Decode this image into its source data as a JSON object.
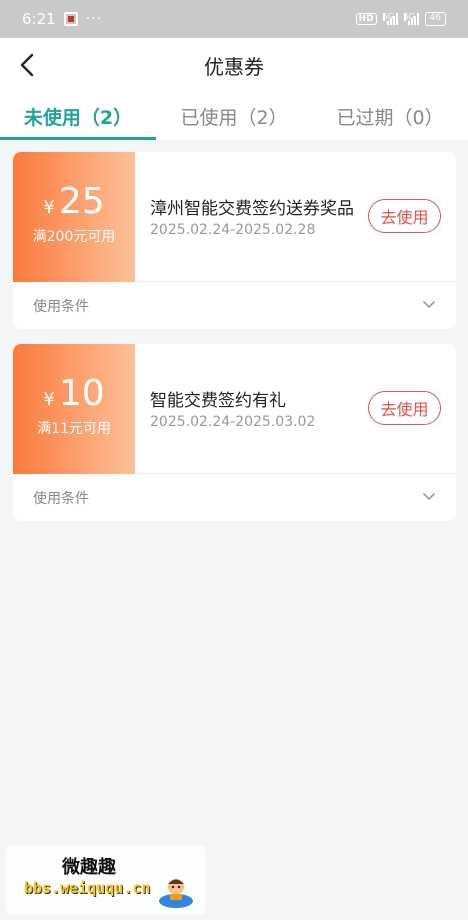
{
  "status_bar": {
    "time": "6:21",
    "dots": "···",
    "hd": "HD",
    "net1": "5G",
    "net2": "5G",
    "battery": "46"
  },
  "header": {
    "title": "优惠券"
  },
  "tabs": [
    {
      "label": "未使用（2）",
      "active": true
    },
    {
      "label": "已使用（2）",
      "active": false
    },
    {
      "label": "已过期（0）",
      "active": false
    }
  ],
  "coupons": [
    {
      "currency": "¥",
      "amount": "25",
      "threshold": "满200元可用",
      "title": "漳州智能交费签约送券奖品",
      "date_range": "2025.02.24-2025.02.28",
      "action_label": "去使用",
      "conditions_label": "使用条件"
    },
    {
      "currency": "¥",
      "amount": "10",
      "threshold": "满11元可用",
      "title": "智能交费签约有礼",
      "date_range": "2025.02.24-2025.03.02",
      "action_label": "去使用",
      "conditions_label": "使用条件"
    }
  ],
  "watermark": {
    "title": "微趣趣",
    "url": "bbs.weiququ.cn"
  },
  "colors": {
    "accent": "#23a39a",
    "coupon_gradient_start": "#fb7a3d",
    "coupon_gradient_end": "#fcc199",
    "action_red": "#d9534f"
  }
}
